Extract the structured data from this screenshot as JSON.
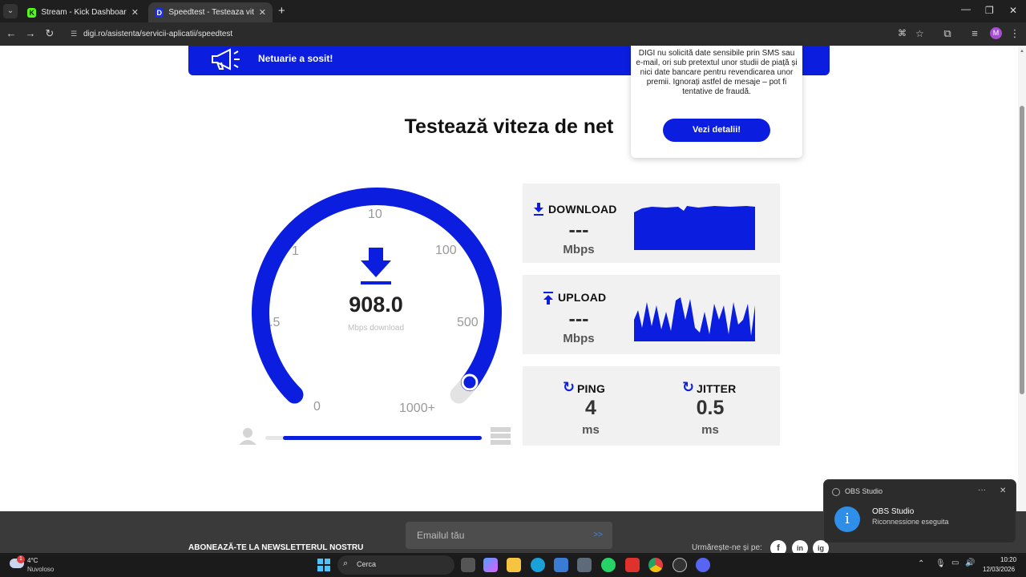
{
  "browser": {
    "tabs": [
      {
        "title": "Stream - Kick Dashboard",
        "favicon": "K"
      },
      {
        "title": "Speedtest - Testeaza viteza inte",
        "favicon": "D"
      }
    ],
    "url": "digi.ro/asistenta/servicii-aplicatii/speedtest",
    "profile_initial": "M"
  },
  "banner": {
    "text": "Netuarie a sosit!"
  },
  "heading": "Testează viteza de net",
  "gauge": {
    "ticks": [
      "0",
      ".5",
      "1",
      "10",
      "100",
      "500",
      "1000+"
    ],
    "value": "908.0",
    "unit": "Mbps download",
    "fraction": 0.97,
    "progress_fraction": 1.0
  },
  "panels": {
    "download": {
      "label": "DOWNLOAD",
      "value": "---",
      "unit": "Mbps"
    },
    "upload": {
      "label": "UPLOAD",
      "value": "---",
      "unit": "Mbps"
    },
    "ping": {
      "label": "PING",
      "value": "4",
      "unit": "ms"
    },
    "jitter": {
      "label": "JITTER",
      "value": "0.5",
      "unit": "ms"
    }
  },
  "popup": {
    "message": "DIGI nu solicită date sensibile prin SMS sau e-mail, ori sub pretextul unor studii de piață și nici date bancare pentru revendicarea unor premii. Ignorați astfel de mesaje – pot fi tentative de fraudă.",
    "button": "Vezi detalii!"
  },
  "footer": {
    "newsletter_label": "ABONEAZĂ-TE LA NEWSLETTERUL NOSTRU",
    "email_placeholder": "Emailul tău",
    "email_go": ">>",
    "follow_label": "Urmărește-ne și pe:",
    "social": [
      "f",
      "in",
      "ig"
    ]
  },
  "toast": {
    "app": "OBS Studio",
    "title": "OBS Studio",
    "body": "Riconnessione eseguita",
    "more": "···",
    "close": "✕"
  },
  "taskbar": {
    "weather_temp": "4°C",
    "weather_desc": "Nuvoloso",
    "weather_badge": "1",
    "search_label": "Cerca",
    "time": "10:20",
    "date": "12/03/2026"
  },
  "colors": {
    "brand": "#0b1ee0",
    "panel": "#f1f1f1",
    "footer": "#3a3a3a"
  }
}
